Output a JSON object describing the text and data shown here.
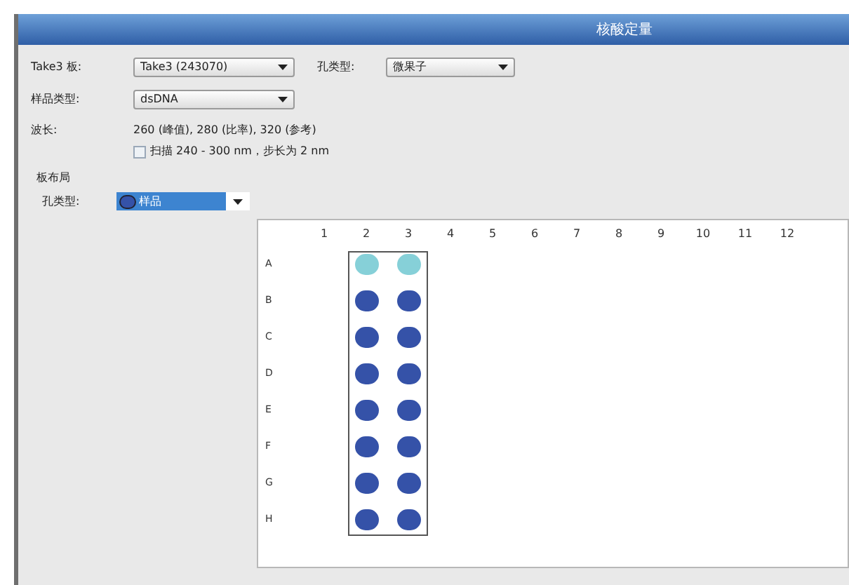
{
  "window": {
    "title": "核酸定量"
  },
  "form": {
    "plate_label": "Take3 板:",
    "plate_value": "Take3 (243070)",
    "well_type_label": "孔类型:",
    "well_type_value": "微果子",
    "sample_type_label": "样品类型:",
    "sample_type_value": "dsDNA",
    "wavelength_label": "波长:",
    "wavelength_value": "260 (峰值), 280 (比率), 320 (参考)",
    "scan": {
      "label": "扫描 240 - 300 nm，步长为 2 nm",
      "checked": false
    }
  },
  "layout": {
    "title": "板布局",
    "well_type_label": "孔类型:",
    "well_type_value": "样品"
  },
  "plate": {
    "columns": [
      "1",
      "2",
      "3",
      "4",
      "5",
      "6",
      "7",
      "8",
      "9",
      "10",
      "11",
      "12"
    ],
    "rows": [
      {
        "label": "A",
        "wells": [
          {
            "kind": "empty"
          },
          {
            "kind": "filled",
            "color": "#86d0d8"
          },
          {
            "kind": "filled",
            "color": "#86d0d8"
          },
          {
            "kind": "empty"
          },
          {
            "kind": "empty"
          },
          {
            "kind": "empty"
          },
          {
            "kind": "empty"
          },
          {
            "kind": "empty"
          },
          {
            "kind": "empty"
          },
          {
            "kind": "empty"
          },
          {
            "kind": "empty"
          },
          {
            "kind": "empty"
          }
        ]
      },
      {
        "label": "B",
        "wells": [
          {
            "kind": "empty"
          },
          {
            "kind": "filled",
            "color": "#3552a8"
          },
          {
            "kind": "filled",
            "color": "#3552a8"
          },
          {
            "kind": "empty"
          },
          {
            "kind": "empty"
          },
          {
            "kind": "empty"
          },
          {
            "kind": "empty"
          },
          {
            "kind": "empty"
          },
          {
            "kind": "empty"
          },
          {
            "kind": "empty"
          },
          {
            "kind": "empty"
          },
          {
            "kind": "empty"
          }
        ]
      },
      {
        "label": "C",
        "wells": [
          {
            "kind": "empty"
          },
          {
            "kind": "filled",
            "color": "#3552a8"
          },
          {
            "kind": "filled",
            "color": "#3552a8"
          },
          {
            "kind": "empty"
          },
          {
            "kind": "empty"
          },
          {
            "kind": "empty"
          },
          {
            "kind": "empty"
          },
          {
            "kind": "empty"
          },
          {
            "kind": "empty"
          },
          {
            "kind": "empty"
          },
          {
            "kind": "empty"
          },
          {
            "kind": "empty"
          }
        ]
      },
      {
        "label": "D",
        "wells": [
          {
            "kind": "empty"
          },
          {
            "kind": "filled",
            "color": "#3552a8"
          },
          {
            "kind": "filled",
            "color": "#3552a8"
          },
          {
            "kind": "empty"
          },
          {
            "kind": "empty"
          },
          {
            "kind": "empty"
          },
          {
            "kind": "empty"
          },
          {
            "kind": "empty"
          },
          {
            "kind": "empty"
          },
          {
            "kind": "empty"
          },
          {
            "kind": "empty"
          },
          {
            "kind": "empty"
          }
        ]
      },
      {
        "label": "E",
        "wells": [
          {
            "kind": "empty"
          },
          {
            "kind": "filled",
            "color": "#3552a8"
          },
          {
            "kind": "filled",
            "color": "#3552a8"
          },
          {
            "kind": "empty"
          },
          {
            "kind": "empty"
          },
          {
            "kind": "empty"
          },
          {
            "kind": "empty"
          },
          {
            "kind": "empty"
          },
          {
            "kind": "empty"
          },
          {
            "kind": "empty"
          },
          {
            "kind": "empty"
          },
          {
            "kind": "empty"
          }
        ]
      },
      {
        "label": "F",
        "wells": [
          {
            "kind": "empty"
          },
          {
            "kind": "filled",
            "color": "#3552a8"
          },
          {
            "kind": "filled",
            "color": "#3552a8"
          },
          {
            "kind": "empty"
          },
          {
            "kind": "empty"
          },
          {
            "kind": "empty"
          },
          {
            "kind": "empty"
          },
          {
            "kind": "empty"
          },
          {
            "kind": "empty"
          },
          {
            "kind": "empty"
          },
          {
            "kind": "empty"
          },
          {
            "kind": "empty"
          }
        ]
      },
      {
        "label": "G",
        "wells": [
          {
            "kind": "empty"
          },
          {
            "kind": "filled",
            "color": "#3552a8"
          },
          {
            "kind": "filled",
            "color": "#3552a8"
          },
          {
            "kind": "empty"
          },
          {
            "kind": "empty"
          },
          {
            "kind": "empty"
          },
          {
            "kind": "empty"
          },
          {
            "kind": "empty"
          },
          {
            "kind": "empty"
          },
          {
            "kind": "empty"
          },
          {
            "kind": "empty"
          },
          {
            "kind": "empty"
          }
        ]
      },
      {
        "label": "H",
        "wells": [
          {
            "kind": "empty"
          },
          {
            "kind": "filled",
            "color": "#3552a8"
          },
          {
            "kind": "filled",
            "color": "#3552a8"
          },
          {
            "kind": "empty"
          },
          {
            "kind": "empty"
          },
          {
            "kind": "empty"
          },
          {
            "kind": "empty"
          },
          {
            "kind": "empty"
          },
          {
            "kind": "empty"
          },
          {
            "kind": "empty"
          },
          {
            "kind": "empty"
          },
          {
            "kind": "empty"
          }
        ]
      }
    ]
  }
}
